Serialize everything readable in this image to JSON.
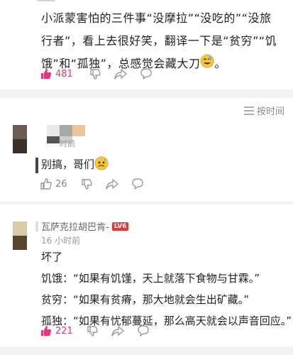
{
  "post": {
    "text": "小派蒙害怕的三件事“没摩拉”“没吃的”“没旅行者”，看上去很好笑，翻译一下是“贫穷”“饥饿”和“孤独”，总感觉会藏大刀",
    "emoji": "sweat-smile-emoji",
    "end": "。",
    "likes": "481"
  },
  "sort_label": "按时间",
  "comments": [
    {
      "time_partial": "时前",
      "text": "别搞，哥们",
      "emoji": "sweat-emoji",
      "likes": "26"
    },
    {
      "username": "瓦萨克拉胡巴肯-",
      "level": "LV6",
      "time": "16 小时前",
      "lines": [
        "坏了",
        "饥饿：“如果有饥馑，天上就落下食物与甘霖。”",
        "贫穷：“如果有贫瘠，那大地就会生出矿藏。”",
        "孤独：“如果有忧郁蔓延，那么高天就会以声音回应。”"
      ],
      "likes": "221"
    }
  ],
  "colors": {
    "like_active": "#e8347d",
    "icon_gray": "#9a9a9a",
    "level_badge": "#e2383a"
  }
}
